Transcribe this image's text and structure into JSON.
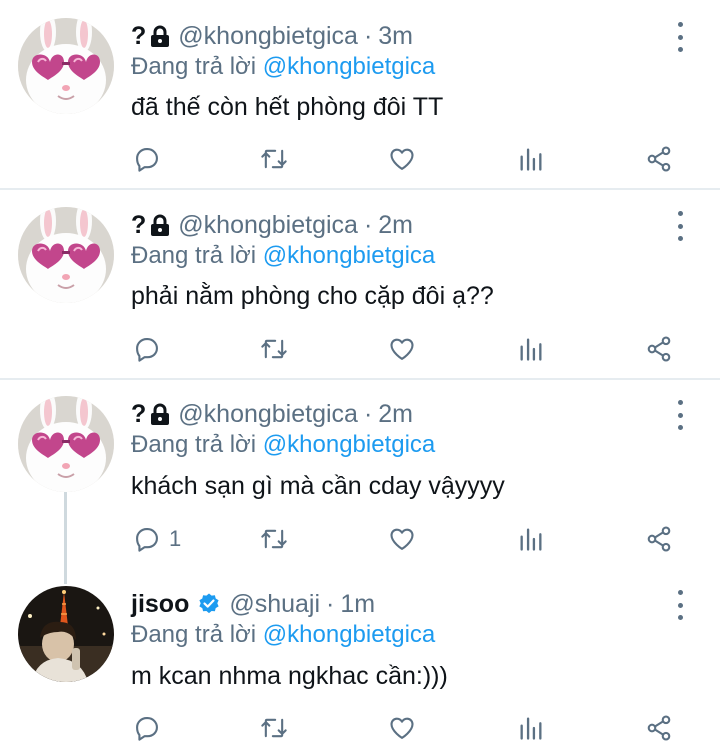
{
  "tweets": [
    {
      "name": "?",
      "handle": "@khongbietgica",
      "dot": "·",
      "time": "3m",
      "replying_prefix": "Đang trả lời",
      "replying_to": "@khongbietgica",
      "text": "đã thế còn hết phòng đôi TT",
      "reply_count": ""
    },
    {
      "name": "?",
      "handle": "@khongbietgica",
      "dot": "·",
      "time": "2m",
      "replying_prefix": "Đang trả lời",
      "replying_to": "@khongbietgica",
      "text": "phải nằm phòng cho cặp đôi ạ??",
      "reply_count": ""
    },
    {
      "name": "?",
      "handle": "@khongbietgica",
      "dot": "·",
      "time": "2m",
      "replying_prefix": "Đang trả lời",
      "replying_to": "@khongbietgica",
      "text": "khách sạn gì mà cần cday vậyyyy",
      "reply_count": "1"
    },
    {
      "name": "jisoo",
      "handle": "@shuaji",
      "dot": "·",
      "time": "1m",
      "replying_prefix": "Đang trả lời",
      "replying_to": "@khongbietgica",
      "text": "m kcan nhma ngkhac cần:)))",
      "reply_count": ""
    }
  ],
  "colors": {
    "mention": "#1d9bf0",
    "secondary_text": "#5b7083",
    "icon": "#5b7083",
    "verified": "#1d9bf0",
    "separator": "#e6ecf0"
  },
  "icons": [
    "lock-icon",
    "verified-badge-icon",
    "more-options-icon",
    "reply-icon",
    "retweet-icon",
    "like-icon",
    "analytics-icon",
    "share-icon"
  ]
}
